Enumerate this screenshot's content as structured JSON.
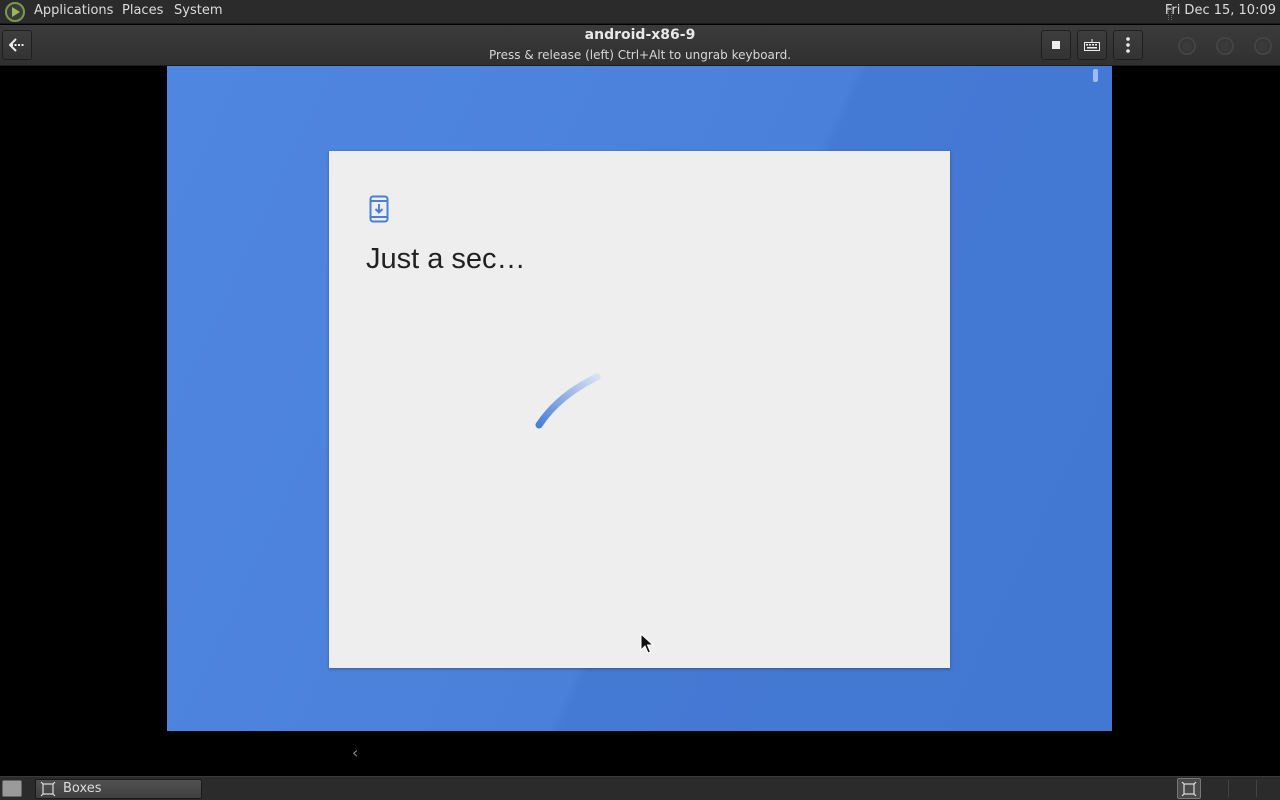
{
  "top_panel": {
    "menus": [
      "Applications",
      "Places",
      "System"
    ],
    "clock": "Fri Dec 15, 10:09"
  },
  "headerbar": {
    "title": "android-x86-9",
    "subtitle": "Press & release (left) Ctrl+Alt to ungrab keyboard."
  },
  "vm": {
    "card_title": "Just a sec…"
  },
  "taskbar": {
    "boxes_label": "Boxes"
  },
  "colors": {
    "vm_background": "#4b80da",
    "card_background": "#eeeeee",
    "android_accent": "#4a7fd8"
  }
}
